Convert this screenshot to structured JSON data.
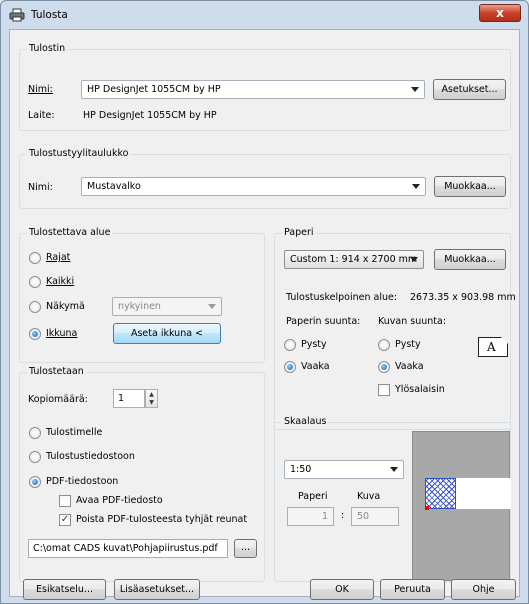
{
  "window": {
    "title": "Tulosta",
    "close_label": "x"
  },
  "printer": {
    "group_label": "Tulostin",
    "name_label": "Nimi:",
    "name_value": "HP DesignJet 1055CM by HP",
    "settings_button": "Asetukset...",
    "device_label": "Laite:",
    "device_value": "HP DesignJet 1055CM by HP"
  },
  "style_table": {
    "group_label": "Tulostustyylitaulukko",
    "name_label": "Nimi:",
    "name_value": "Mustavalko",
    "edit_button": "Muokkaa..."
  },
  "print_area": {
    "group_label": "Tulostettava alue",
    "options": [
      "Rajat",
      "Kaikki",
      "Näkymä",
      "Ikkuna"
    ],
    "selected": "Ikkuna",
    "view_value": "nykyinen",
    "set_window_button": "Aseta ikkuna <"
  },
  "paper": {
    "group_label": "Paperi",
    "size_value": "Custom 1: 914 x 2700 mm",
    "edit_button": "Muokkaa...",
    "printable_label": "Tulostuskelpoinen alue:",
    "printable_value": "2673.35 x 903.98 mm",
    "paper_orientation_label": "Paperin suunta:",
    "image_orientation_label": "Kuvan suunta:",
    "paper_portrait": "Pysty",
    "paper_landscape": "Vaaka",
    "image_portrait": "Pysty",
    "image_landscape": "Vaaka",
    "upside_down": "Ylösalaisin",
    "orientation_glyph": "A"
  },
  "output": {
    "group_label": "Tulostetaan",
    "copies_label": "Kopiomäärä:",
    "copies_value": "1",
    "to_printer": "Tulostimelle",
    "to_file": "Tulostustiedostoon",
    "to_pdf": "PDF-tiedostoon",
    "open_pdf": "Avaa PDF-tiedosto",
    "remove_margins": "Poista PDF-tulosteesta tyhjät reunat",
    "pdf_path": "C:\\omat CADS kuvat\\Pohjapiirustus.pdf",
    "browse_button": "..."
  },
  "scale": {
    "group_label": "Skaalaus",
    "value": "1:50",
    "paper_label": "Paperi",
    "image_label": "Kuva",
    "paper_value": "1",
    "separator": ":",
    "image_value": "50"
  },
  "buttons": {
    "preview": "Esikatselu...",
    "more_settings": "Lisäasetukset...",
    "ok": "OK",
    "cancel": "Peruuta",
    "help": "Ohje"
  }
}
